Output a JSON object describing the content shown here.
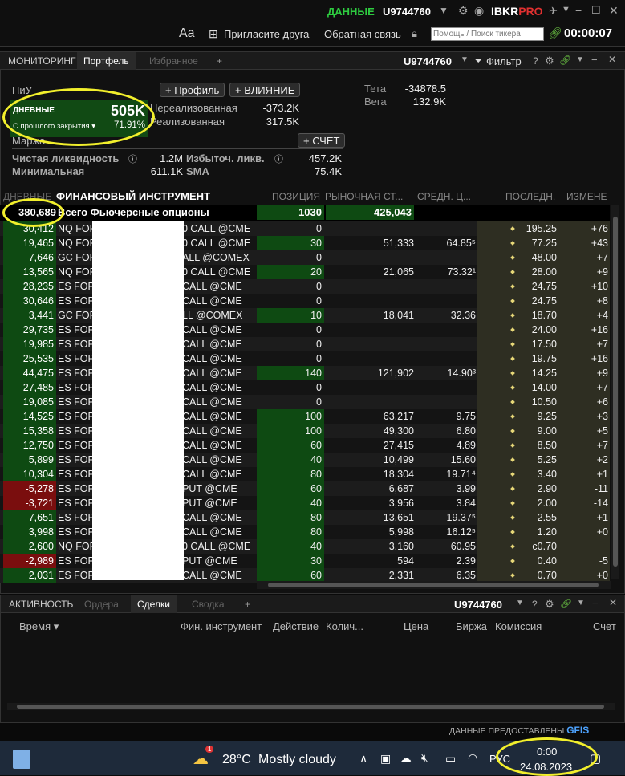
{
  "topbar": {
    "data_label": "ДАННЫЕ",
    "account": "U9744760",
    "brand": "IBKR",
    "brand_pro": "PRO"
  },
  "toolbar": {
    "font_btn": "Aa",
    "invite": "Пригласите друга",
    "feedback": "Обратная связь",
    "search_placeholder": "Помощь / Поиск тикера",
    "time": "00:00:07"
  },
  "tabs": [
    {
      "label": "МОНИТОРИНГ"
    },
    {
      "label": "Портфель"
    },
    {
      "label": "Избранное"
    },
    {
      "label": "+"
    }
  ],
  "panel": {
    "account": "U9744760",
    "filter": "Фильтр",
    "help": "?"
  },
  "summary": {
    "pnl_title": "ПиУ",
    "profile_btn": "+ Профиль",
    "impact_btn": "+ ВЛИЯНИЕ",
    "daily_label": "ДНЕВНЫЕ",
    "daily_value": "505K",
    "since_close": "С прошлого закрытия",
    "daily_pct": "71.91%",
    "unrealized_label": "Нереализованная",
    "unrealized_value": "-373.2K",
    "realized_label": "Реализованная",
    "realized_value": "317.5K",
    "theta_label": "Тета",
    "theta_value": "-34878.5",
    "vega_label": "Вега",
    "vega_value": "132.9K",
    "margin_label": "Маржа",
    "account_btn": "+ СЧЕТ",
    "net_liq_label": "Чистая ликвидность",
    "net_liq_value": "1.2M",
    "excess_liq_label": "Избыточ. ликв.",
    "excess_liq_value": "457.2K",
    "min_label": "Минимальная",
    "min_value": "611.1K",
    "sma_label": "SMA",
    "sma_value": "75.4K"
  },
  "columns": {
    "daily": "ДНЕВНЫЕ",
    "instrument": "ФИНАНСОВЫЙ ИНСТРУМЕНТ",
    "position": "ПОЗИЦИЯ",
    "market": "РЫНОЧНАЯ СТ...",
    "avg": "СРЕДН. Ц...",
    "last": "ПОСЛЕДН.",
    "change": "ИЗМЕНЕ"
  },
  "total": {
    "pnl": "380,689",
    "label": "Всего Фьючерсные опционы",
    "position": "1030",
    "market": "425,043"
  },
  "rows": [
    {
      "pnl": "30,412",
      "sym": "NQ FOP",
      "inst": "0 CALL @CME",
      "pos": "0",
      "mkt": "",
      "avg": "",
      "last": "195.25",
      "chg": "+76",
      "neg": false,
      "hl": false
    },
    {
      "pnl": "19,465",
      "sym": "NQ FOP",
      "inst": "0 CALL @CME",
      "pos": "30",
      "mkt": "51,333",
      "avg": "64.85⁵",
      "last": "77.25",
      "chg": "+43",
      "neg": false,
      "hl": true
    },
    {
      "pnl": "7,646",
      "sym": "GC FOP",
      "inst": "ALL @COMEX",
      "pos": "0",
      "mkt": "",
      "avg": "",
      "last": "48.00",
      "chg": "+7",
      "neg": false,
      "hl": false
    },
    {
      "pnl": "13,565",
      "sym": "NQ FOP",
      "inst": "0 CALL @CME",
      "pos": "20",
      "mkt": "21,065",
      "avg": "73.32¹",
      "last": "28.00",
      "chg": "+9",
      "neg": false,
      "hl": true
    },
    {
      "pnl": "28,235",
      "sym": "ES FOP",
      "inst": "CALL @CME",
      "pos": "0",
      "mkt": "",
      "avg": "",
      "last": "24.75",
      "chg": "+10",
      "neg": false,
      "hl": false
    },
    {
      "pnl": "30,646",
      "sym": "ES FOP",
      "inst": "CALL @CME",
      "pos": "0",
      "mkt": "",
      "avg": "",
      "last": "24.75",
      "chg": "+8",
      "neg": false,
      "hl": false
    },
    {
      "pnl": "3,441",
      "sym": "GC FOP",
      "inst": "LL @COMEX",
      "pos": "10",
      "mkt": "18,041",
      "avg": "32.36",
      "last": "18.70",
      "chg": "+4",
      "neg": false,
      "hl": true
    },
    {
      "pnl": "29,735",
      "sym": "ES FOP",
      "inst": "CALL @CME",
      "pos": "0",
      "mkt": "",
      "avg": "",
      "last": "24.00",
      "chg": "+16",
      "neg": false,
      "hl": false
    },
    {
      "pnl": "19,985",
      "sym": "ES FOP",
      "inst": "CALL @CME",
      "pos": "0",
      "mkt": "",
      "avg": "",
      "last": "17.50",
      "chg": "+7",
      "neg": false,
      "hl": false
    },
    {
      "pnl": "25,535",
      "sym": "ES FOP",
      "inst": "CALL @CME",
      "pos": "0",
      "mkt": "",
      "avg": "",
      "last": "19.75",
      "chg": "+16",
      "neg": false,
      "hl": false
    },
    {
      "pnl": "44,475",
      "sym": "ES FOP",
      "inst": "CALL @CME",
      "pos": "140",
      "mkt": "121,902",
      "avg": "14.90³",
      "last": "14.25",
      "chg": "+9",
      "neg": false,
      "hl": true
    },
    {
      "pnl": "27,485",
      "sym": "ES FOP",
      "inst": "CALL @CME",
      "pos": "0",
      "mkt": "",
      "avg": "",
      "last": "14.00",
      "chg": "+7",
      "neg": false,
      "hl": false
    },
    {
      "pnl": "19,085",
      "sym": "ES FOP",
      "inst": "CALL @CME",
      "pos": "0",
      "mkt": "",
      "avg": "",
      "last": "10.50",
      "chg": "+6",
      "neg": false,
      "hl": false
    },
    {
      "pnl": "14,525",
      "sym": "ES FOP",
      "inst": "CALL @CME",
      "pos": "100",
      "mkt": "63,217",
      "avg": "9.75",
      "last": "9.25",
      "chg": "+3",
      "neg": false,
      "hl": true
    },
    {
      "pnl": "15,358",
      "sym": "ES FOP",
      "inst": "CALL @CME",
      "pos": "100",
      "mkt": "49,300",
      "avg": "6.80",
      "last": "9.00",
      "chg": "+5",
      "neg": false,
      "hl": true
    },
    {
      "pnl": "12,750",
      "sym": "ES FOP",
      "inst": "CALL @CME",
      "pos": "60",
      "mkt": "27,415",
      "avg": "4.89",
      "last": "8.50",
      "chg": "+7",
      "neg": false,
      "hl": true
    },
    {
      "pnl": "5,899",
      "sym": "ES FOP",
      "inst": "CALL @CME",
      "pos": "40",
      "mkt": "10,499",
      "avg": "15.60",
      "last": "5.25",
      "chg": "+2",
      "neg": false,
      "hl": true
    },
    {
      "pnl": "10,304",
      "sym": "ES FOP",
      "inst": "CALL @CME",
      "pos": "80",
      "mkt": "18,304",
      "avg": "19.71⁴",
      "last": "3.40",
      "chg": "+1",
      "neg": false,
      "hl": true
    },
    {
      "pnl": "-5,278",
      "sym": "ES FOP",
      "inst": "PUT @CME",
      "pos": "60",
      "mkt": "6,687",
      "avg": "3.99",
      "last": "2.90",
      "chg": "-11",
      "neg": true,
      "hl": true
    },
    {
      "pnl": "-3,721",
      "sym": "ES FOP",
      "inst": "PUT @CME",
      "pos": "40",
      "mkt": "3,956",
      "avg": "3.84",
      "last": "2.00",
      "chg": "-14",
      "neg": true,
      "hl": true
    },
    {
      "pnl": "7,651",
      "sym": "ES FOP",
      "inst": "CALL @CME",
      "pos": "80",
      "mkt": "13,651",
      "avg": "19.37⁵",
      "last": "2.55",
      "chg": "+1",
      "neg": false,
      "hl": true
    },
    {
      "pnl": "3,998",
      "sym": "ES FOP",
      "inst": "CALL @CME",
      "pos": "80",
      "mkt": "5,998",
      "avg": "16.12⁵",
      "last": "1.20",
      "chg": "+0",
      "neg": false,
      "hl": true
    },
    {
      "pnl": "2,600",
      "sym": "NQ FOP",
      "inst": "0 CALL @CME",
      "pos": "40",
      "mkt": "3,160",
      "avg": "60.95",
      "last": "c0.70",
      "chg": "",
      "neg": false,
      "hl": true
    },
    {
      "pnl": "-2,989",
      "sym": "ES FOP",
      "inst": "PUT @CME",
      "pos": "30",
      "mkt": "594",
      "avg": "2.39",
      "last": "0.40",
      "chg": "-5",
      "neg": true,
      "hl": true
    },
    {
      "pnl": "2,031",
      "sym": "ES FOP",
      "inst": "CALL @CME",
      "pos": "60",
      "mkt": "2,331",
      "avg": "6.35",
      "last": "0.70",
      "chg": "+0",
      "neg": false,
      "hl": true
    }
  ],
  "bottom": {
    "tabs": [
      {
        "label": "АКТИВНОСТЬ"
      },
      {
        "label": "Ордера"
      },
      {
        "label": "Сделки"
      },
      {
        "label": "Сводка"
      },
      {
        "label": "+"
      }
    ],
    "account": "U9744760",
    "cols": {
      "time": "Время",
      "instrument": "Фин. инструмент",
      "action": "Действие",
      "qty": "Колич...",
      "price": "Цена",
      "exchange": "Биржа",
      "commission": "Комиссия",
      "account": "Счет"
    },
    "provider": "ДАННЫЕ ПРЕДОСТАВЛЕНЫ",
    "provider_brand": "GFIS"
  },
  "taskbar": {
    "temp": "28°C",
    "weather": "Mostly cloudy",
    "lang": "РУС",
    "time": "0:00",
    "date": "24.08.2023",
    "badge": "1"
  }
}
